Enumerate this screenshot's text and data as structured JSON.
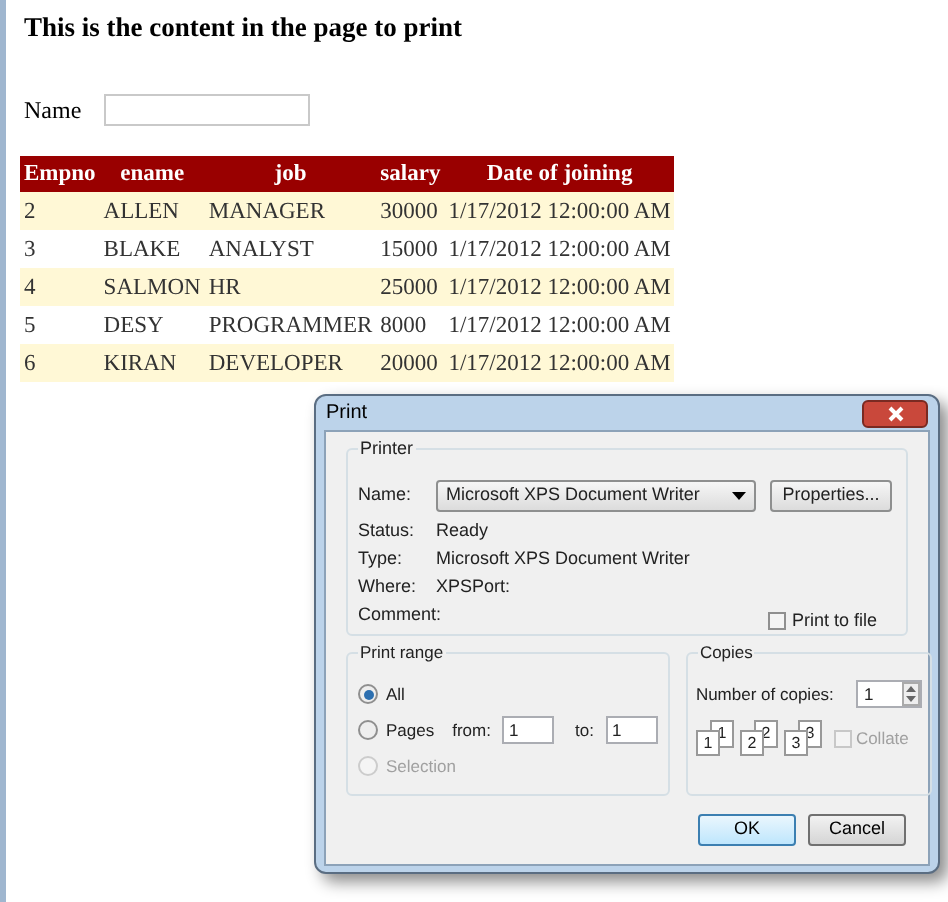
{
  "page": {
    "heading": "This is the content in the page to print",
    "name_field": {
      "label": "Name"
    }
  },
  "table": {
    "columns": [
      "Empno",
      "ename",
      "job",
      "salary",
      "Date of joining"
    ],
    "rows": [
      [
        "2",
        "ALLEN",
        "MANAGER",
        "30000",
        "1/17/2012 12:00:00 AM"
      ],
      [
        "3",
        "BLAKE",
        "ANALYST",
        "15000",
        "1/17/2012 12:00:00 AM"
      ],
      [
        "4",
        "SALMON",
        "HR",
        "25000",
        "1/17/2012 12:00:00 AM"
      ],
      [
        "5",
        "DESY",
        "PROGRAMMER",
        "8000",
        "1/17/2012 12:00:00 AM"
      ],
      [
        "6",
        "KIRAN",
        "DEVELOPER",
        "20000",
        "1/17/2012 12:00:00 AM"
      ]
    ]
  },
  "dialog": {
    "title": "Print",
    "printer": {
      "title": "Printer",
      "name_label": "Name:",
      "printer": "Microsoft XPS Document Writer",
      "properties_button": "Properties...",
      "info": [
        {
          "label": "Status:",
          "value": "Ready"
        },
        {
          "label": "Type:",
          "value": "Microsoft XPS Document Writer"
        },
        {
          "label": "Where:",
          "value": "XPSPort:"
        },
        {
          "label": "Comment:"
        }
      ],
      "print_to_file": {
        "label": "Print to file",
        "checked": false
      }
    },
    "print_range": {
      "title": "Print range",
      "options": [
        {
          "label": "All",
          "selected": true,
          "disabled": false
        },
        {
          "label": "Pages",
          "selected": false,
          "disabled": false
        },
        {
          "label": "Selection",
          "selected": false,
          "disabled": true
        }
      ],
      "from_label": "from:",
      "from_value": "1",
      "to_label": "to:",
      "to_value": "1"
    },
    "copies": {
      "title": "Copies",
      "label": "Number of copies:",
      "value": "1",
      "collate_pages": [
        {
          "front": "1",
          "back": "1"
        },
        {
          "front": "2",
          "back": "2"
        },
        {
          "front": "3",
          "back": "3"
        }
      ],
      "collate": {
        "label": "Collate",
        "checked": false,
        "disabled": true
      }
    },
    "buttons": [
      {
        "label": "OK",
        "default": true
      },
      {
        "label": "Cancel",
        "default": false
      }
    ]
  }
}
